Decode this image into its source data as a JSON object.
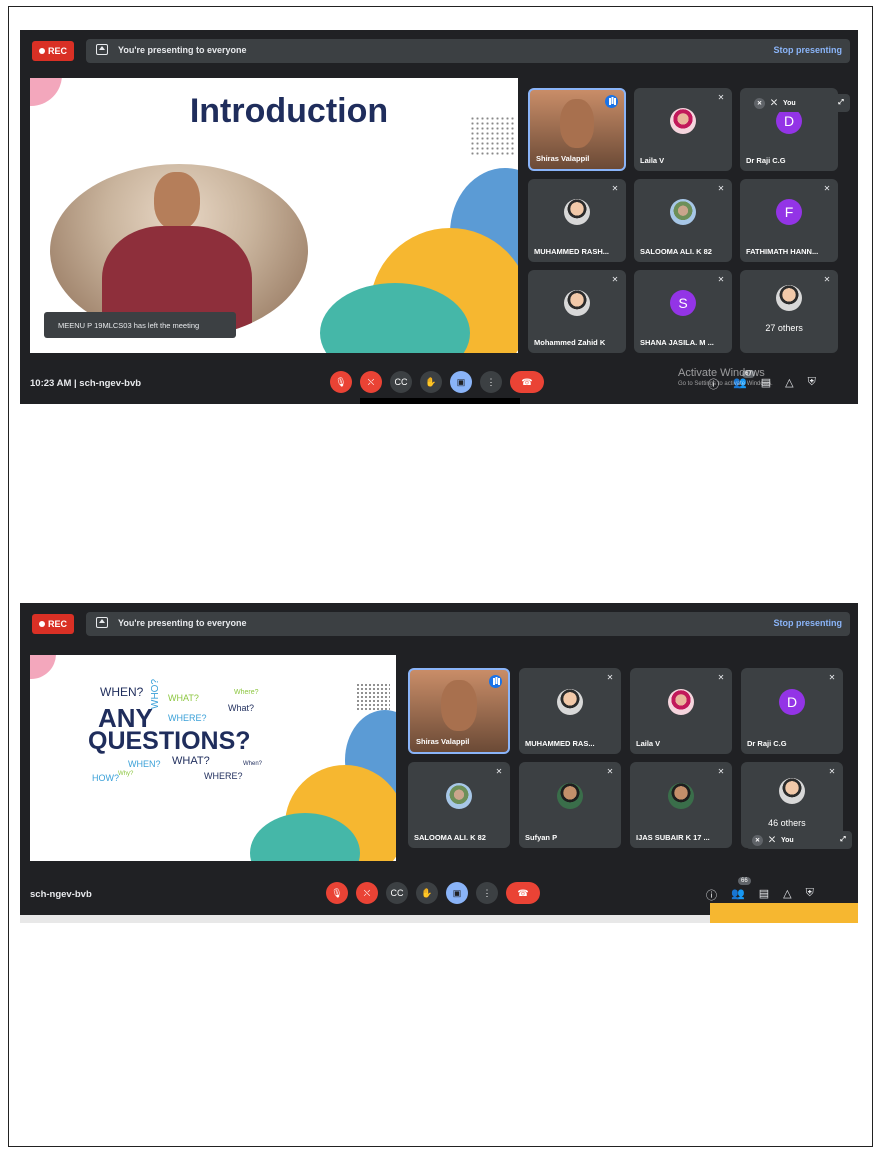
{
  "screens": [
    {
      "rec_label": "REC",
      "presenting_text": "You're presenting to everyone",
      "stop_label": "Stop presenting",
      "slide_title": "Introduction",
      "toast": "MEENU P 19MLCS03 has left the meeting",
      "meeting_info": "10:23 AM  |  sch-ngev-bvb",
      "participants_count": "67",
      "watermark_line1": "Activate Windows",
      "watermark_line2": "Go to Settings to activate Windows.",
      "self_view_label": "You",
      "tiles": [
        {
          "name": "Shiras Valappil",
          "type": "photo",
          "speaking": true
        },
        {
          "name": "Laila V",
          "type": "photo-p"
        },
        {
          "name": "Dr Raji C.G",
          "type": "letter",
          "letter": "D"
        },
        {
          "name": "MUHAMMED RASH...",
          "type": "photo"
        },
        {
          "name": "SALOOMA ALI. K 82",
          "type": "photo-g"
        },
        {
          "name": "FATHIMATH HANN...",
          "type": "letter",
          "letter": "F"
        },
        {
          "name": "Mohammed Zahid K",
          "type": "photo"
        },
        {
          "name": "SHANA JASILA. M ...",
          "type": "letter",
          "letter": "S"
        },
        {
          "name": "27 others",
          "type": "others"
        }
      ]
    },
    {
      "rec_label": "REC",
      "presenting_text": "You're presenting to everyone",
      "stop_label": "Stop presenting",
      "meeting_info": "sch-ngev-bvb",
      "participants_count": "66",
      "self_view_label": "You",
      "wordcloud": {
        "main1": "ANY",
        "main2": "QUESTIONS?",
        "words": [
          "WHEN?",
          "WHO?",
          "WHAT?",
          "WHERE?",
          "What?",
          "Where?",
          "WHEN?",
          "WHAT?",
          "HOW?",
          "WHERE?",
          "Why?",
          "When?"
        ]
      },
      "tiles": [
        {
          "name": "Shiras Valappil",
          "type": "photo",
          "speaking": true
        },
        {
          "name": "MUHAMMED RAS...",
          "type": "photo"
        },
        {
          "name": "Laila V",
          "type": "photo-p"
        },
        {
          "name": "Dr Raji C.G",
          "type": "letter",
          "letter": "D"
        },
        {
          "name": "SALOOMA ALI. K 82",
          "type": "photo-g"
        },
        {
          "name": "Sufyan P",
          "type": "photo-b"
        },
        {
          "name": "IJAS SUBAIR K 17 ...",
          "type": "photo-b"
        },
        {
          "name": "46 others",
          "type": "others"
        }
      ]
    }
  ]
}
